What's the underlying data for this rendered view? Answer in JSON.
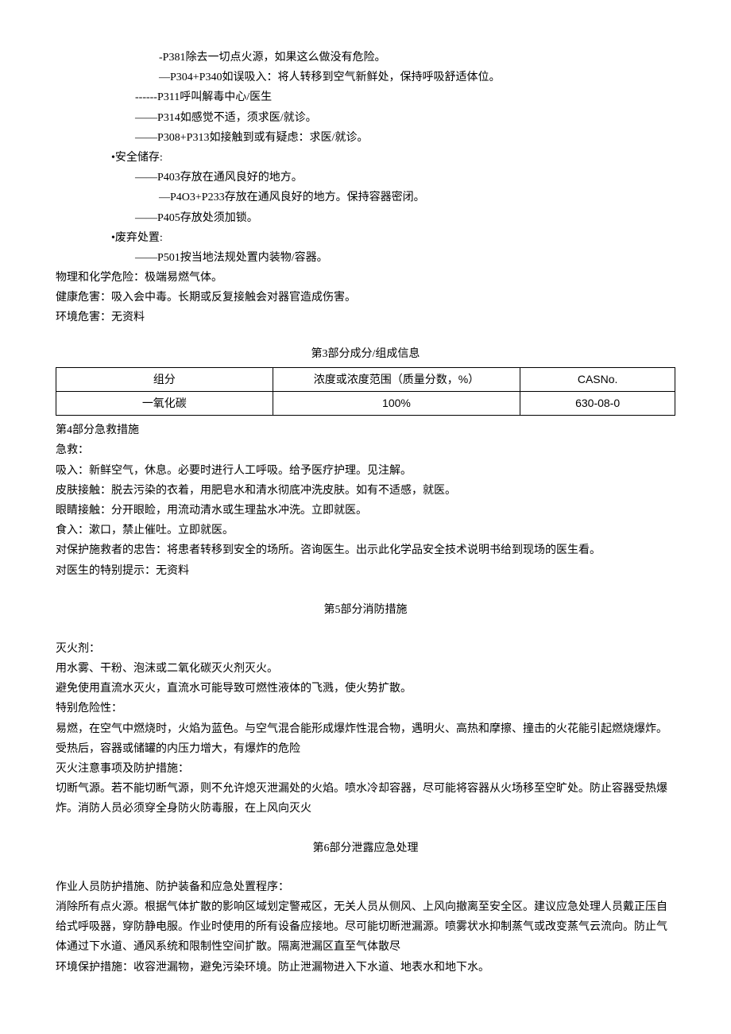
{
  "precautions": {
    "p381": "-P381除去一切点火源，如果这么做没有危险。",
    "p304_340": "—P304+P340如误吸入：将人转移到空气新鲜处，保持呼吸舒适体位。",
    "p311": "------P311呼叫解毒中心/医生",
    "p314": "——P314如感觉不适，须求医/就诊。",
    "p308_313": "——P308+P313如接触到或有疑虑：求医/就诊。"
  },
  "storage": {
    "header": "•安全储存:",
    "p403": "——P403存放在通风良好的地方。",
    "p403_233": "—P4O3+P233存放在通风良好的地方。保持容器密闭。",
    "p405": "——P405存放处须加锁。"
  },
  "disposal": {
    "header": "•废弃处置:",
    "p501": "——P501按当地法规处置内装物/容器。"
  },
  "hazards": {
    "physical": "物理和化学危险：极端易燃气体。",
    "health": "健康危害：吸入会中毒。长期或反复接触会对器官造成伤害。",
    "environment": "环境危害：无资料"
  },
  "section3": {
    "title": "第3部分成分/组成信息",
    "headers": {
      "component": "组分",
      "concentration": "浓度或浓度范围（质量分数，%）",
      "cas": "CASNo."
    },
    "row": {
      "component": "一氧化碳",
      "concentration": "100%",
      "cas": "630-08-0"
    }
  },
  "section4": {
    "title": "第4部分急救措施",
    "first_aid_label": "急救：",
    "inhalation": "吸入：新鲜空气，休息。必要时进行人工呼吸。给予医疗护理。见注解。",
    "skin": "皮肤接触：脱去污染的衣着，用肥皂水和清水彻底冲洗皮肤。如有不适感，就医。",
    "eyes": "眼睛接触：分开眼睑，用流动清水或生理盐水冲洗。立即就医。",
    "ingestion": "食入：漱口，禁止催吐。立即就医。",
    "rescuer": "对保护施救者的忠告：将患者转移到安全的场所。咨询医生。出示此化学品安全技术说明书给到现场的医生看。",
    "doctor": "对医生的特别提示：无资料"
  },
  "section5": {
    "title": "第5部分消防措施",
    "extinguisher_label": "灭火剂：",
    "extinguisher_use": "用水雾、干粉、泡沫或二氧化碳灭火剂灭火。",
    "extinguisher_avoid": "避免使用直流水灭火，直流水可能导致可燃性液体的飞溅，使火势扩散。",
    "special_hazard_label": "特别危险性：",
    "special_hazard": "易燃，在空气中燃烧时，火焰为蓝色。与空气混合能形成爆炸性混合物，遇明火、高热和摩擦、撞击的火花能引起燃烧爆炸。受热后，容器或储罐的内压力增大，有爆炸的危险",
    "firefight_label": "灭火注意事项及防护措施：",
    "firefight": "切断气源。若不能切断气源，则不允许熄灭泄漏处的火焰。喷水冷却容器，尽可能将容器从火场移至空旷处。防止容器受热爆炸。消防人员必须穿全身防火防毒服，在上风向灭火"
  },
  "section6": {
    "title": "第6部分泄露应急处理",
    "personnel_label": "作业人员防护措施、防护装备和应急处置程序：",
    "personnel": "消除所有点火源。根据气体扩散的影响区域划定警戒区，无关人员从侧风、上风向撤离至安全区。建议应急处理人员戴正压自给式呼吸器，穿防静电服。作业时使用的所有设备应接地。尽可能切断泄漏源。喷雾状水抑制蒸气或改变蒸气云流向。防止气体通过下水道、通风系统和限制性空间扩散。隔离泄漏区直至气体散尽",
    "environment": "环境保护措施：收容泄漏物，避免污染环境。防止泄漏物进入下水道、地表水和地下水。"
  }
}
